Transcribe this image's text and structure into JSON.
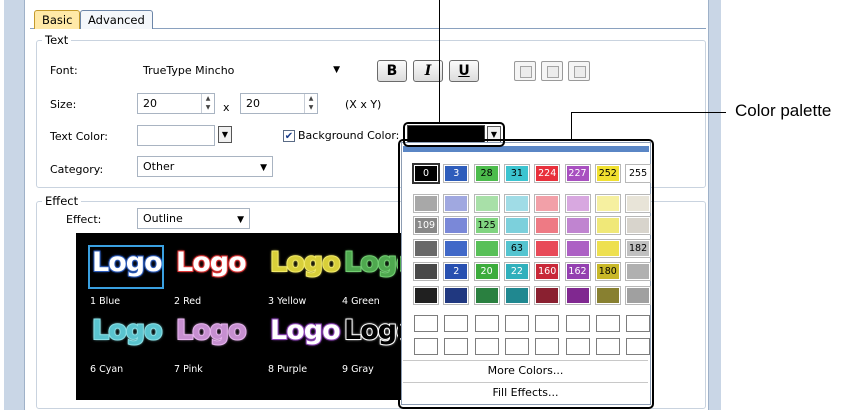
{
  "tabs": [
    {
      "label": "Basic"
    },
    {
      "label": "Advanced"
    }
  ],
  "text_group": {
    "title": "Text",
    "font_label": "Font:",
    "font_value": "TrueType Mincho",
    "size_label": "Size:",
    "size_x": "20",
    "size_times": "x",
    "size_y": "20",
    "size_hint": "(X x Y)",
    "text_color_label": "Text Color:",
    "background_checkbox_checked": true,
    "background_color_label": "Background Color:",
    "background_color_value": "#000000",
    "category_label": "Category:",
    "category_value": "Other",
    "format_buttons": [
      {
        "label": "B",
        "icon": "bold-icon"
      },
      {
        "label": "I",
        "icon": "italic-icon"
      },
      {
        "label": "U",
        "icon": "underline-icon"
      }
    ],
    "align_buttons": [
      "align-left-icon",
      "align-center-icon",
      "align-right-icon"
    ]
  },
  "effect_group": {
    "title": "Effect",
    "effect_label": "Effect:",
    "effect_value": "Outline",
    "preview_word": "Logo",
    "presets": [
      {
        "name": "1 Blue",
        "fill": "#ffffff",
        "stroke": "#2e5dbb",
        "selected": true
      },
      {
        "name": "2 Red",
        "fill": "#ffffff",
        "stroke": "#e23a3a"
      },
      {
        "name": "3 Yellow",
        "fill": "#d8cf3a",
        "stroke": "#f2ea6a"
      },
      {
        "name": "4 Green",
        "fill": "#4fa84f",
        "stroke": "#74cf74"
      },
      {
        "name": "6 Cyan",
        "fill": "#5ac4cf",
        "stroke": "#8be0e6"
      },
      {
        "name": "7 Pink",
        "fill": "#c68fd0",
        "stroke": "#e7b4ee"
      },
      {
        "name": "8 Purple",
        "fill": "#ffffff",
        "stroke": "#8f47b9"
      },
      {
        "name": "9 Gray",
        "fill": "#000000",
        "stroke": "#ffffff"
      }
    ]
  },
  "palette": {
    "rows": [
      [
        {
          "c": "#000000",
          "t": "0",
          "tc": "#ffffff",
          "sel": true
        },
        {
          "c": "#2e5dbb",
          "t": "3",
          "tc": "#ffffff"
        },
        {
          "c": "#4cbc4c",
          "t": "28",
          "tc": "#000000"
        },
        {
          "c": "#3cc4d0",
          "t": "31",
          "tc": "#000000"
        },
        {
          "c": "#e8303c",
          "t": "224",
          "tc": "#ffffff"
        },
        {
          "c": "#a850c0",
          "t": "227",
          "tc": "#ffffff"
        },
        {
          "c": "#f0e030",
          "t": "252",
          "tc": "#000000"
        },
        {
          "c": "#ffffff",
          "t": "255",
          "tc": "#000000"
        }
      ],
      [
        {
          "c": "#a8a8a8"
        },
        {
          "c": "#a0a8e0"
        },
        {
          "c": "#a8e0a8"
        },
        {
          "c": "#a0dce6"
        },
        {
          "c": "#f2a0a8"
        },
        {
          "c": "#d8a8e0"
        },
        {
          "c": "#f6f0a0"
        },
        {
          "c": "#e8e4d8"
        }
      ],
      [
        {
          "c": "#888888",
          "t": "109",
          "tc": "#ffffff"
        },
        {
          "c": "#7a88d8"
        },
        {
          "c": "#80d480",
          "t": "125",
          "tc": "#000000"
        },
        {
          "c": "#7cd0dc"
        },
        {
          "c": "#ee7a84"
        },
        {
          "c": "#c084d0"
        },
        {
          "c": "#f0e878"
        },
        {
          "c": "#d8d4cc"
        }
      ],
      [
        {
          "c": "#686868"
        },
        {
          "c": "#4068c8"
        },
        {
          "c": "#58c058"
        },
        {
          "c": "#54c4d0",
          "t": "63",
          "tc": "#000000"
        },
        {
          "c": "#e84a58"
        },
        {
          "c": "#ac60c4"
        },
        {
          "c": "#eee050"
        },
        {
          "c": "#c0c0c0",
          "t": "182",
          "tc": "#000000"
        }
      ],
      [
        {
          "c": "#484848"
        },
        {
          "c": "#2850b0",
          "t": "2",
          "tc": "#ffffff"
        },
        {
          "c": "#3cac3c",
          "t": "20",
          "tc": "#ffffff"
        },
        {
          "c": "#30b0bc",
          "t": "22",
          "tc": "#ffffff"
        },
        {
          "c": "#c82838",
          "t": "160",
          "tc": "#ffffff"
        },
        {
          "c": "#9440b0",
          "t": "162",
          "tc": "#ffffff"
        },
        {
          "c": "#c8b828",
          "t": "180",
          "tc": "#000000"
        },
        {
          "c": "#b0b0b0"
        }
      ],
      [
        {
          "c": "#202020"
        },
        {
          "c": "#203880"
        },
        {
          "c": "#2a8040"
        },
        {
          "c": "#208890"
        },
        {
          "c": "#8a2030"
        },
        {
          "c": "#802890"
        },
        {
          "c": "#888030"
        },
        {
          "c": "#a0a0a0"
        }
      ]
    ],
    "custom_rows": 2,
    "custom_cols": 8,
    "more_colors": "More Colors...",
    "fill_effects": "Fill Effects..."
  },
  "callout": {
    "label": "Color palette"
  }
}
